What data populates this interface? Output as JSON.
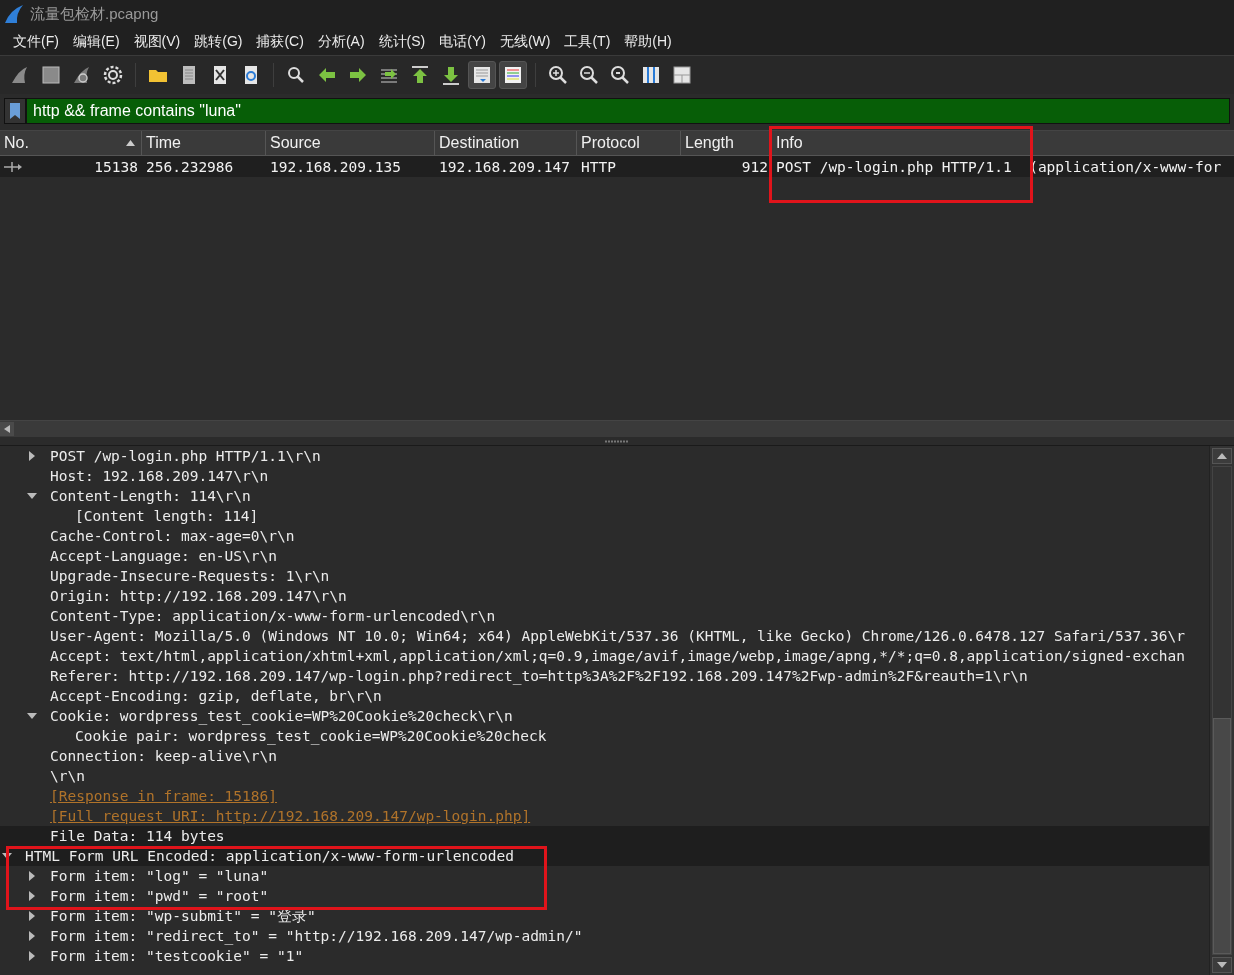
{
  "window": {
    "title": "流量包检材.pcapng"
  },
  "menu": [
    "文件(F)",
    "编辑(E)",
    "视图(V)",
    "跳转(G)",
    "捕获(C)",
    "分析(A)",
    "统计(S)",
    "电话(Y)",
    "无线(W)",
    "工具(T)",
    "帮助(H)"
  ],
  "toolbar": [
    {
      "kind": "start",
      "pressed": false
    },
    {
      "kind": "stop",
      "pressed": false
    },
    {
      "kind": "restart",
      "pressed": false
    },
    {
      "kind": "options",
      "pressed": false
    },
    {
      "kind": "separator"
    },
    {
      "kind": "open",
      "pressed": false
    },
    {
      "kind": "save",
      "pressed": false
    },
    {
      "kind": "close",
      "pressed": false
    },
    {
      "kind": "reload",
      "pressed": false
    },
    {
      "kind": "separator"
    },
    {
      "kind": "find",
      "pressed": false
    },
    {
      "kind": "back",
      "pressed": false
    },
    {
      "kind": "forward",
      "pressed": false
    },
    {
      "kind": "goto",
      "pressed": false
    },
    {
      "kind": "first",
      "pressed": false
    },
    {
      "kind": "last",
      "pressed": false
    },
    {
      "kind": "autoscroll",
      "pressed": true
    },
    {
      "kind": "colorize",
      "pressed": true
    },
    {
      "kind": "separator"
    },
    {
      "kind": "zoom_in",
      "pressed": false
    },
    {
      "kind": "zoom_out",
      "pressed": false
    },
    {
      "kind": "zoom_reset",
      "pressed": false
    },
    {
      "kind": "resize",
      "pressed": false
    },
    {
      "kind": "layout",
      "pressed": false
    }
  ],
  "filter": {
    "value": "http && frame contains \"luna\""
  },
  "packet_list": {
    "columns": [
      {
        "label": "No.",
        "sorted": true
      },
      {
        "label": "Time",
        "sorted": false
      },
      {
        "label": "Source",
        "sorted": false
      },
      {
        "label": "Destination",
        "sorted": false
      },
      {
        "label": "Protocol",
        "sorted": false
      },
      {
        "label": "Length",
        "sorted": false
      },
      {
        "label": "Info",
        "sorted": false
      }
    ],
    "rows": [
      {
        "cells": [
          "15138",
          "256.232986",
          "192.168.209.135",
          "192.168.209.147",
          "HTTP",
          "912",
          "POST /wp-login.php HTTP/1.1  (application/x-www-for"
        ]
      }
    ]
  },
  "detail": {
    "http_fields": [
      {
        "text": "POST /wp-login.php HTTP/1.1\\r\\n",
        "kind": "field",
        "expanded": false
      },
      {
        "text": "Host: 192.168.209.147\\r\\n",
        "kind": "field"
      },
      {
        "text": "Content-Length: 114\\r\\n",
        "kind": "field",
        "expanded": true,
        "children": [
          {
            "text": "[Content length: 114]",
            "kind": "field"
          }
        ]
      },
      {
        "text": "Cache-Control: max-age=0\\r\\n",
        "kind": "field"
      },
      {
        "text": "Accept-Language: en-US\\r\\n",
        "kind": "field"
      },
      {
        "text": "Upgrade-Insecure-Requests: 1\\r\\n",
        "kind": "field"
      },
      {
        "text": "Origin: http://192.168.209.147\\r\\n",
        "kind": "field"
      },
      {
        "text": "Content-Type: application/x-www-form-urlencoded\\r\\n",
        "kind": "field"
      },
      {
        "text": "User-Agent: Mozilla/5.0 (Windows NT 10.0; Win64; x64) AppleWebKit/537.36 (KHTML, like Gecko) Chrome/126.0.6478.127 Safari/537.36\\r",
        "kind": "field"
      },
      {
        "text": "Accept: text/html,application/xhtml+xml,application/xml;q=0.9,image/avif,image/webp,image/apng,*/*;q=0.8,application/signed-exchan",
        "kind": "field"
      },
      {
        "text": "Referer: http://192.168.209.147/wp-login.php?redirect_to=http%3A%2F%2F192.168.209.147%2Fwp-admin%2F&reauth=1\\r\\n",
        "kind": "field"
      },
      {
        "text": "Accept-Encoding: gzip, deflate, br\\r\\n",
        "kind": "field"
      },
      {
        "text": "Cookie: wordpress_test_cookie=WP%20Cookie%20check\\r\\n",
        "kind": "field",
        "expanded": true,
        "children": [
          {
            "text": "Cookie pair: wordpress_test_cookie=WP%20Cookie%20check",
            "kind": "field"
          }
        ]
      },
      {
        "text": "Connection: keep-alive\\r\\n",
        "kind": "field"
      },
      {
        "text": "\\r\\n",
        "kind": "field"
      },
      {
        "text": "[Response in frame: 15186]",
        "kind": "link"
      },
      {
        "text": "[Full request URI: http://192.168.209.147/wp-login.php]",
        "kind": "link"
      },
      {
        "text": "File Data: 114 bytes",
        "kind": "field",
        "highlighted": true
      }
    ],
    "form": {
      "text": "HTML Form URL Encoded: application/x-www-form-urlencoded",
      "kind": "field",
      "expanded": true,
      "highlighted": true,
      "children": [
        {
          "text": "Form item: \"log\" = \"luna\"",
          "kind": "field",
          "expanded": false
        },
        {
          "text": "Form item: \"pwd\" = \"root\"",
          "kind": "field",
          "expanded": false
        },
        {
          "text": "Form item: \"wp-submit\" = \"登录\"",
          "kind": "field",
          "expanded": false
        },
        {
          "text": "Form item: \"redirect_to\" = \"http://192.168.209.147/wp-admin/\"",
          "kind": "field",
          "expanded": false
        },
        {
          "text": "Form item: \"testcookie\" = \"1\"",
          "kind": "field",
          "expanded": false
        }
      ]
    }
  }
}
